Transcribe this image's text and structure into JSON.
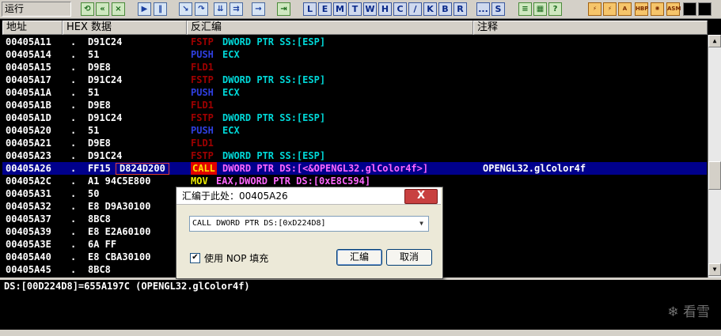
{
  "toolbar": {
    "status": "运行",
    "letter_buttons": [
      "L",
      "E",
      "M",
      "T",
      "W",
      "H",
      "C",
      "/",
      "K",
      "B",
      "R",
      "...",
      "S"
    ],
    "plugin_buttons": [
      "HBP",
      "ASM"
    ]
  },
  "columns": {
    "address": "地址",
    "hex": "HEX 数据",
    "disasm": "反汇编",
    "comment": "注释"
  },
  "rows": [
    {
      "addr": "00405A11",
      "dot": ".",
      "hex": "D91C24",
      "mn": "FSTP",
      "op": "DWORD PTR SS:[ESP]",
      "cm": ""
    },
    {
      "addr": "00405A14",
      "dot": ".",
      "hex": "51",
      "mn": "PUSH",
      "op": "ECX",
      "cm": ""
    },
    {
      "addr": "00405A15",
      "dot": ".",
      "hex": "D9E8",
      "mn": "FLD1",
      "op": "",
      "cm": ""
    },
    {
      "addr": "00405A17",
      "dot": ".",
      "hex": "D91C24",
      "mn": "FSTP",
      "op": "DWORD PTR SS:[ESP]",
      "cm": ""
    },
    {
      "addr": "00405A1A",
      "dot": ".",
      "hex": "51",
      "mn": "PUSH",
      "op": "ECX",
      "cm": ""
    },
    {
      "addr": "00405A1B",
      "dot": ".",
      "hex": "D9E8",
      "mn": "FLD1",
      "op": "",
      "cm": ""
    },
    {
      "addr": "00405A1D",
      "dot": ".",
      "hex": "D91C24",
      "mn": "FSTP",
      "op": "DWORD PTR SS:[ESP]",
      "cm": ""
    },
    {
      "addr": "00405A20",
      "dot": ".",
      "hex": "51",
      "mn": "PUSH",
      "op": "ECX",
      "cm": ""
    },
    {
      "addr": "00405A21",
      "dot": ".",
      "hex": "D9E8",
      "mn": "FLD1",
      "op": "",
      "cm": ""
    },
    {
      "addr": "00405A23",
      "dot": ".",
      "hex": "D91C24",
      "mn": "FSTP",
      "op": "DWORD PTR SS:[ESP]",
      "cm": ""
    },
    {
      "addr": "00405A26",
      "dot": ".",
      "hex": "FF15",
      "hex2": "D824D200",
      "mn": "CALL",
      "op": "DWORD PTR DS:[<&OPENGL32.glColor4f>]",
      "cm": "OPENGL32.glColor4f",
      "selected": true
    },
    {
      "addr": "00405A2C",
      "dot": ".",
      "hex": "A1 94C5E800",
      "mn": "MOV",
      "op": "EAX,DWORD PTR DS:[0xE8C594]",
      "cm": ""
    },
    {
      "addr": "00405A31",
      "dot": ".",
      "hex": "50",
      "mn": "",
      "op": "",
      "cm": ""
    },
    {
      "addr": "00405A32",
      "dot": ".",
      "hex": "E8 D9A30100",
      "mn": "",
      "op": "",
      "cm": ""
    },
    {
      "addr": "00405A37",
      "dot": ".",
      "hex": "8BC8",
      "mn": "",
      "op": "",
      "cm": ""
    },
    {
      "addr": "00405A39",
      "dot": ".",
      "hex": "E8 E2A60100",
      "mn": "",
      "op": "",
      "cm": ""
    },
    {
      "addr": "00405A3E",
      "dot": ".",
      "hex": "6A FF",
      "mn": "",
      "op": "",
      "cm": ""
    },
    {
      "addr": "00405A40",
      "dot": ".",
      "hex": "E8 CBA30100",
      "mn": "",
      "op": "",
      "cm": ""
    },
    {
      "addr": "00405A45",
      "dot": ".",
      "hex": "8BC8",
      "mn": "",
      "op": "",
      "cm": ""
    }
  ],
  "info": {
    "line": "DS:[00D224D8]=655A197C (OPENGL32.glColor4f)"
  },
  "watermark": "看雪",
  "dialog": {
    "title": "汇编于此处：00405A26",
    "close": "X",
    "input_value": "CALL DWORD PTR DS:[0xD224D8]",
    "checkbox_label": "使用 NOP 填充",
    "checkbox_checked": true,
    "assemble_button": "汇编",
    "cancel_button": "取消"
  }
}
